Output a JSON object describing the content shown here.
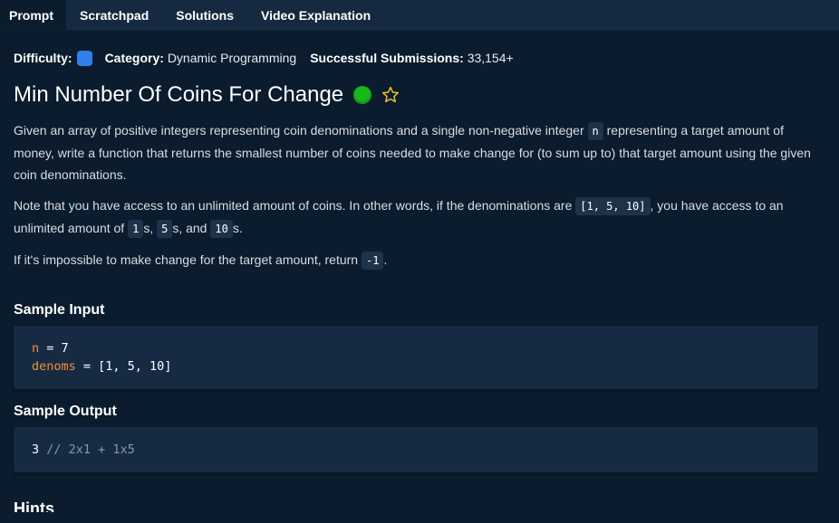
{
  "tabs": [
    "Prompt",
    "Scratchpad",
    "Solutions",
    "Video Explanation"
  ],
  "meta": {
    "difficulty_label": "Difficulty:",
    "category_label": "Category:",
    "category_value": "Dynamic Programming",
    "submissions_label": "Successful Submissions:",
    "submissions_value": "33,154+",
    "difficulty_color": "#2f80ed"
  },
  "title": "Min Number Of Coins For Change",
  "status_color": "#18b918",
  "description": {
    "p1_a": "Given an array of positive integers representing coin denominations and a single non-negative integer ",
    "p1_code": "n",
    "p1_b": " representing a target amount of money, write a function that returns the smallest number of coins needed to make change for (to sum up to) that target amount using the given coin denominations.",
    "p2_a": "Note that you have access to an unlimited amount of coins. In other words, if the denominations are ",
    "p2_code1": "[1, 5, 10]",
    "p2_b": ", you have access to an unlimited amount of ",
    "p2_code2": "1",
    "p2_c": "s, ",
    "p2_code3": "5",
    "p2_d": "s, and ",
    "p2_code4": "10",
    "p2_e": "s.",
    "p3_a": "If it's impossible to make change for the target amount, return ",
    "p3_code": "-1",
    "p3_b": "."
  },
  "sample_input": {
    "heading": "Sample Input",
    "line1_var": "n",
    "line1_rest": " = 7",
    "line2_var": "denoms",
    "line2_rest": " = [1, 5, 10]"
  },
  "sample_output": {
    "heading": "Sample Output",
    "value": "3",
    "comment": " // 2x1 + 1x5"
  },
  "hints_heading": "Hints"
}
